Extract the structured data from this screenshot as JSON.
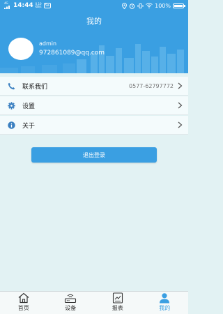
{
  "status_bar": {
    "time": "14:44",
    "speed_value": "0.10",
    "speed_unit": "KB/s",
    "battery_text": "100%",
    "network_badge": "4G",
    "battery_level_percent": 100
  },
  "header": {
    "title": "我的",
    "username": "admin",
    "email": "972861089@qq.com",
    "background_color": "#3a9fe2"
  },
  "menu": {
    "items": [
      {
        "label": "联系我们",
        "value": "0577-62797772",
        "icon": "phone-icon"
      },
      {
        "label": "设置",
        "value": "",
        "icon": "gear-icon"
      },
      {
        "label": "关于",
        "value": "",
        "icon": "info-icon"
      }
    ]
  },
  "logout_label": "退出登录",
  "tabs": [
    {
      "label": "首页",
      "icon": "home-icon",
      "active": false
    },
    {
      "label": "设备",
      "icon": "router-icon",
      "active": false
    },
    {
      "label": "报表",
      "icon": "report-icon",
      "active": false
    },
    {
      "label": "我的",
      "icon": "person-icon",
      "active": true
    }
  ],
  "colors": {
    "accent": "#3a9fe2",
    "page_bg": "#e2f2f3"
  }
}
